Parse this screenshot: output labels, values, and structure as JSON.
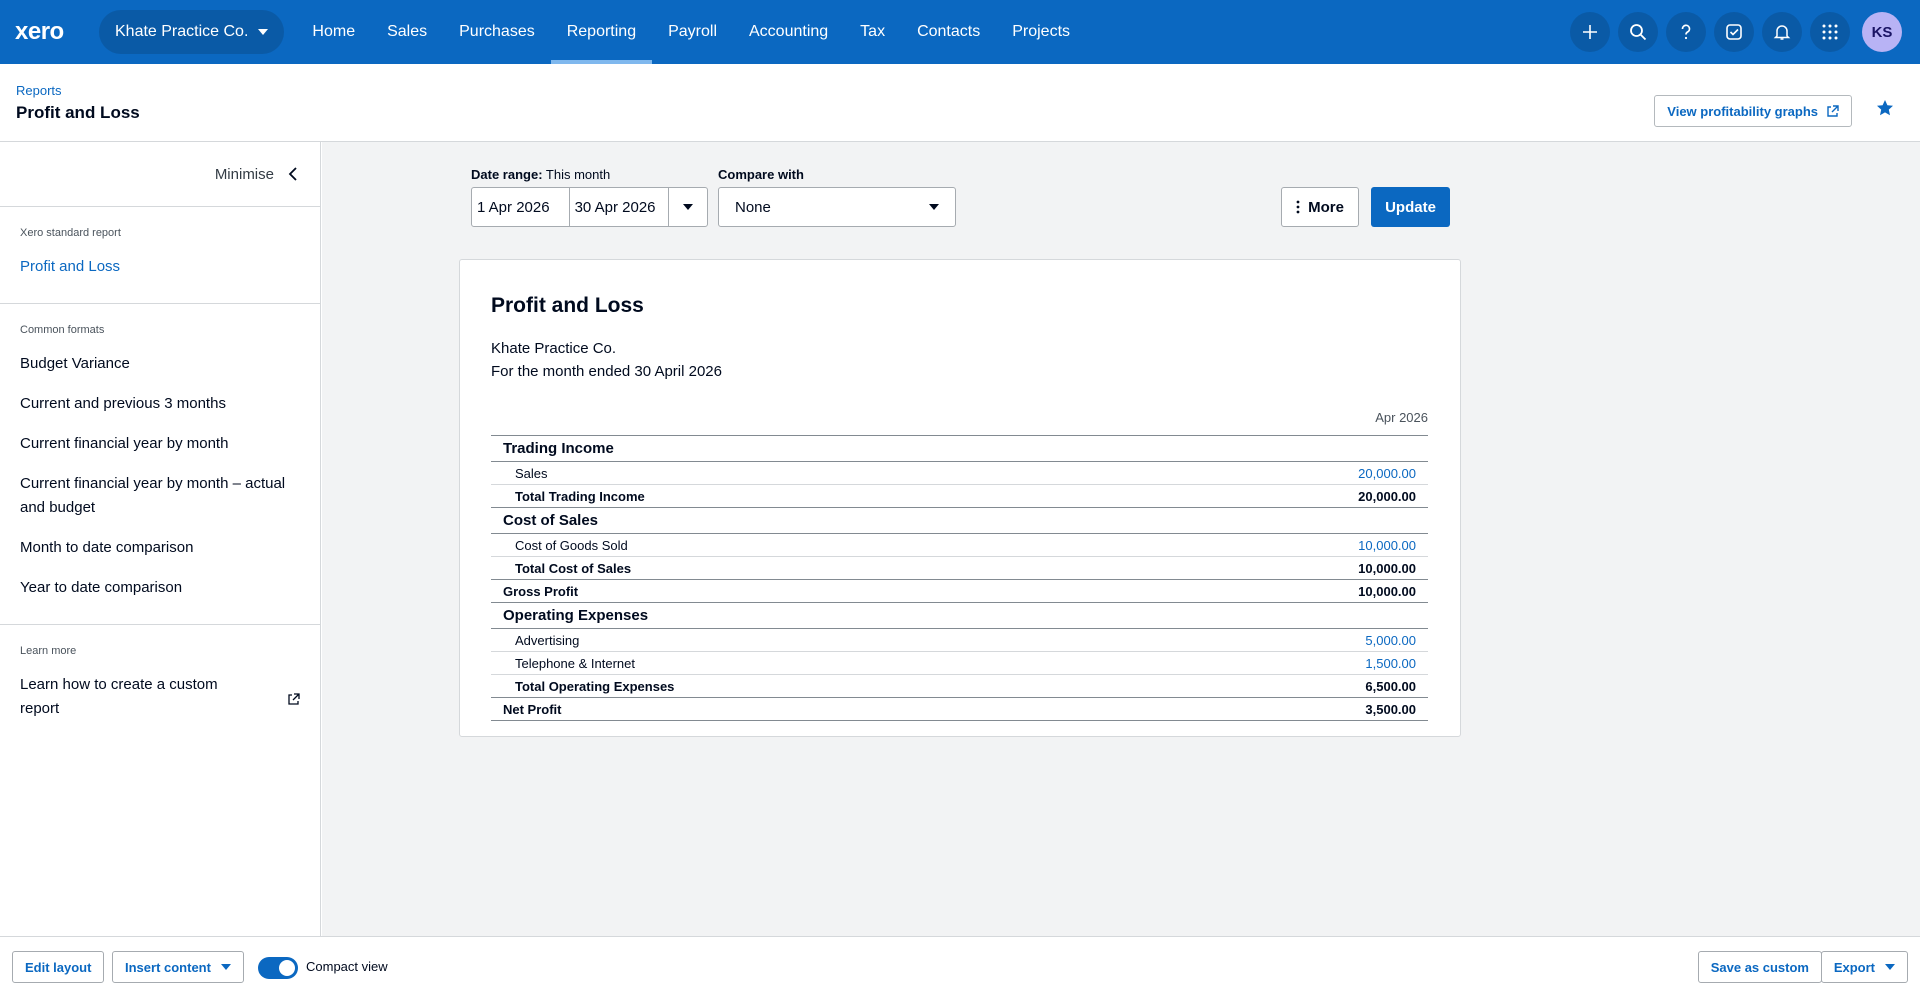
{
  "app": {
    "logo": "xero",
    "org_name": "Khate Practice Co.",
    "user_initials": "KS"
  },
  "nav": {
    "items": [
      "Home",
      "Sales",
      "Purchases",
      "Reporting",
      "Payroll",
      "Accounting",
      "Tax",
      "Contacts",
      "Projects"
    ],
    "active": "Reporting"
  },
  "nav_icons": [
    "plus-icon",
    "search-icon",
    "help-icon",
    "tasks-icon",
    "bell-icon",
    "apps-grid-icon"
  ],
  "header": {
    "breadcrumb": "Reports",
    "title": "Profit and Loss",
    "graphs_button": "View profitability graphs"
  },
  "sidebar": {
    "minimise_label": "Minimise",
    "standard_heading": "Xero standard report",
    "standard_item": "Profit and Loss",
    "formats_heading": "Common formats",
    "formats": [
      "Budget Variance",
      "Current and previous 3 months",
      "Current financial year by month",
      "Current financial year by month – actual and budget",
      "Month to date comparison",
      "Year to date comparison"
    ],
    "learn_heading": "Learn more",
    "learn_item": "Learn how to create a custom report"
  },
  "controls": {
    "date_range_label": "Date range:",
    "date_range_value": "This month",
    "date_from": "1 Apr 2026",
    "date_to": "30 Apr 2026",
    "compare_label": "Compare with",
    "compare_value": "None",
    "more_label": "More",
    "update_label": "Update"
  },
  "report": {
    "title": "Profit and Loss",
    "org": "Khate Practice Co.",
    "period": "For the month ended 30 April 2026",
    "column": "Apr 2026",
    "rows": [
      {
        "type": "section",
        "name": "Trading Income",
        "value": ""
      },
      {
        "type": "item",
        "name": "Sales",
        "value": "20,000.00"
      },
      {
        "type": "total",
        "name": "Total Trading Income",
        "value": "20,000.00"
      },
      {
        "type": "section",
        "name": "Cost of Sales",
        "value": ""
      },
      {
        "type": "item",
        "name": "Cost of Goods Sold",
        "value": "10,000.00"
      },
      {
        "type": "total",
        "name": "Total Cost of Sales",
        "value": "10,000.00"
      },
      {
        "type": "summary",
        "name": "Gross Profit",
        "value": "10,000.00"
      },
      {
        "type": "section",
        "name": "Operating Expenses",
        "value": ""
      },
      {
        "type": "item",
        "name": "Advertising",
        "value": "5,000.00"
      },
      {
        "type": "item",
        "name": "Telephone & Internet",
        "value": "1,500.00"
      },
      {
        "type": "total",
        "name": "Total Operating Expenses",
        "value": "6,500.00"
      },
      {
        "type": "summary",
        "name": "Net Profit",
        "value": "3,500.00"
      }
    ]
  },
  "footer": {
    "edit_layout": "Edit layout",
    "insert_content": "Insert content",
    "compact_view": "Compact view",
    "compact_view_on": true,
    "save_as_custom": "Save as custom",
    "export": "Export"
  },
  "colors": {
    "brand": "#0b68c1",
    "link": "#0b68c1",
    "background": "#f2f3f4"
  }
}
